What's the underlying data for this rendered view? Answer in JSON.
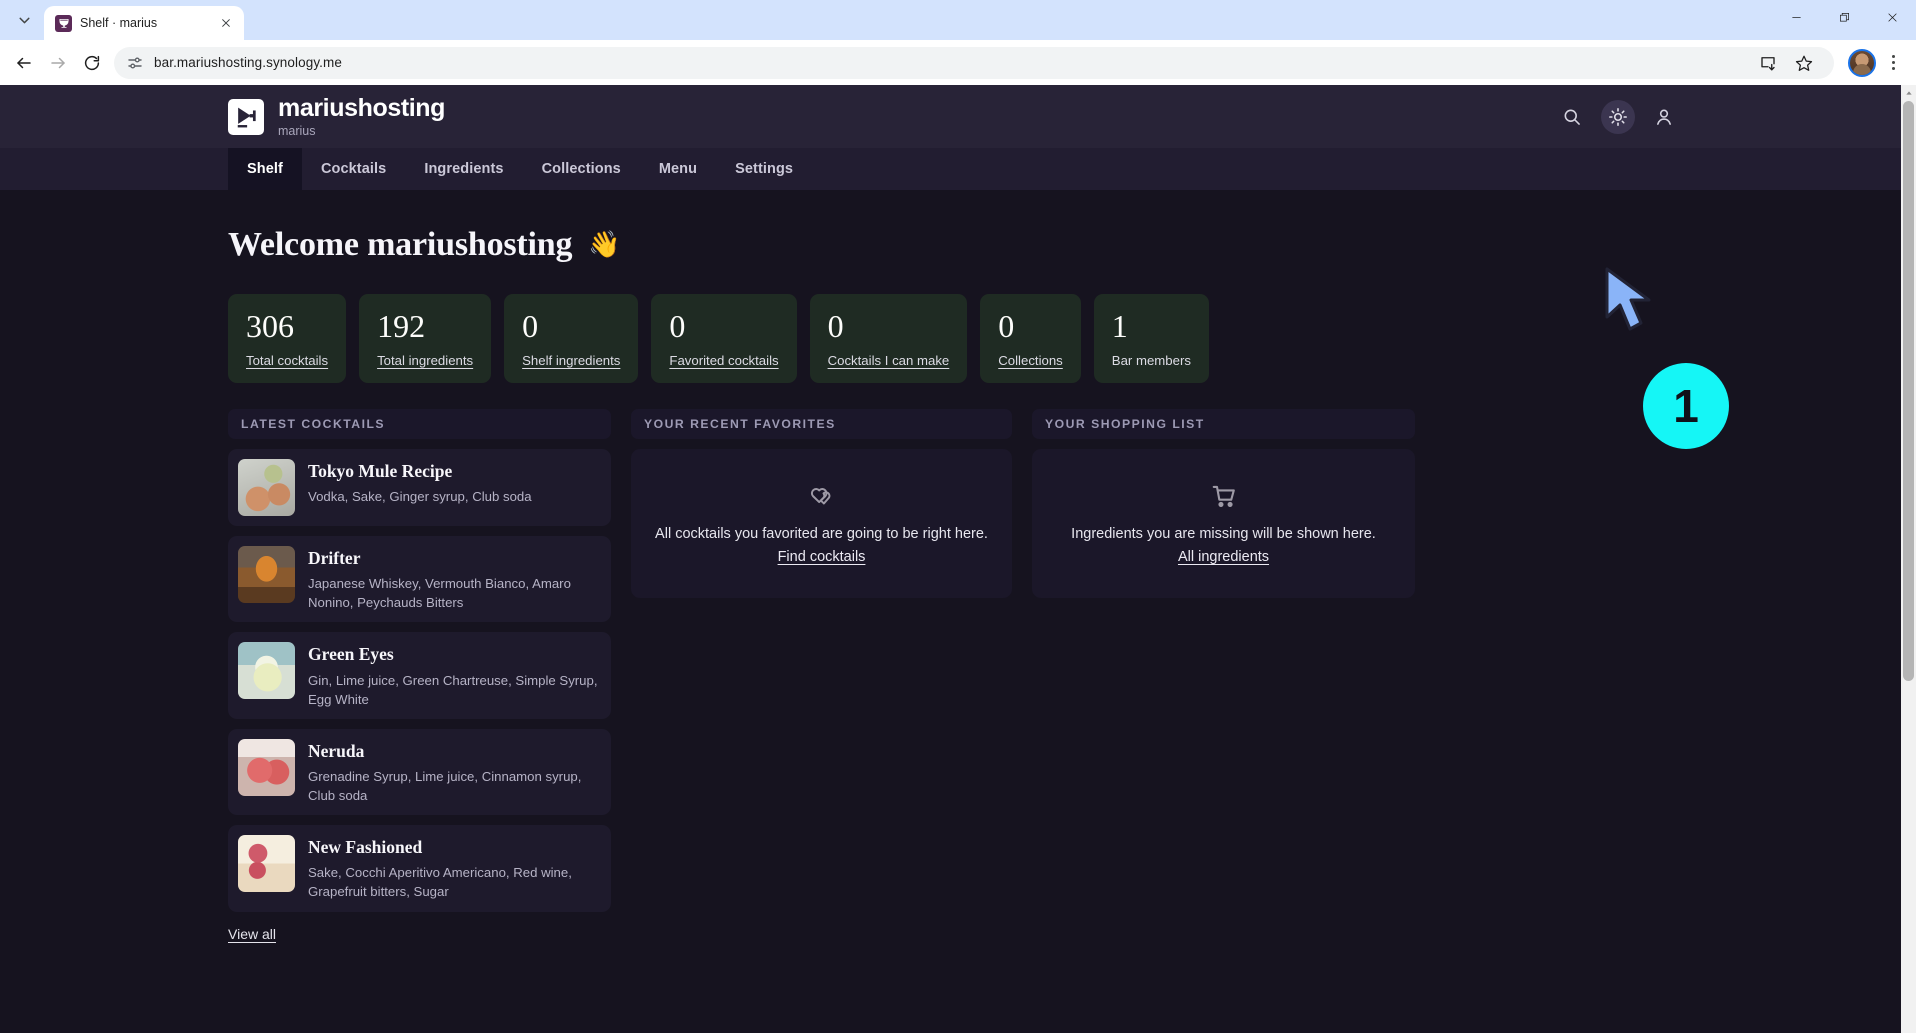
{
  "browser": {
    "tab": {
      "title": "Shelf · marius",
      "favicon_icon": "cocktail-glass-icon",
      "close_icon": "close-icon"
    },
    "tabstrip": {
      "chevron_icon": "chevron-down-icon"
    },
    "window_controls": {
      "minimize": "minimize-icon",
      "maximize": "restore-icon",
      "close": "close-icon"
    },
    "toolbar": {
      "back_icon": "arrow-back-icon",
      "forward_icon": "arrow-forward-icon",
      "reload_icon": "reload-icon",
      "site_info_icon": "tune-settings-icon",
      "url": "bar.mariushosting.synology.me",
      "url_placeholder": "Search Google or type a URL",
      "install_icon": "install-app-icon",
      "bookmark_icon": "star-outline-icon",
      "profile_icon": "account-avatar",
      "menu_icon": "three-dot-menu-icon"
    }
  },
  "site": {
    "brand": {
      "name": "mariushosting",
      "subtitle": "marius",
      "logo_icon": "cocktail-glass-icon"
    },
    "header_actions": [
      {
        "name": "search",
        "icon": "search-icon",
        "hovered": false
      },
      {
        "name": "theme-toggle",
        "icon": "sun-brightness-icon",
        "hovered": true
      },
      {
        "name": "account",
        "icon": "person-icon",
        "hovered": false
      }
    ],
    "nav": [
      {
        "label": "Shelf",
        "active": true
      },
      {
        "label": "Cocktails",
        "active": false
      },
      {
        "label": "Ingredients",
        "active": false
      },
      {
        "label": "Collections",
        "active": false
      },
      {
        "label": "Menu",
        "active": false
      },
      {
        "label": "Settings",
        "active": false
      }
    ],
    "welcome": {
      "text": "Welcome mariushosting",
      "emoji": "👋"
    },
    "stats": [
      {
        "value": "306",
        "label": "Total cocktails",
        "is_link": true
      },
      {
        "value": "192",
        "label": "Total ingredients",
        "is_link": true
      },
      {
        "value": "0",
        "label": "Shelf ingredients",
        "is_link": true
      },
      {
        "value": "0",
        "label": "Favorited cocktails",
        "is_link": true
      },
      {
        "value": "0",
        "label": "Cocktails I can make",
        "is_link": true
      },
      {
        "value": "0",
        "label": "Collections",
        "is_link": true
      },
      {
        "value": "1",
        "label": "Bar members",
        "is_link": false
      }
    ],
    "panels": {
      "latest": {
        "title": "LATEST COCKTAILS",
        "view_all": "View all",
        "items": [
          {
            "name": "Tokyo Mule Recipe",
            "ingredients": "Vodka, Sake, Ginger syrup, Club soda"
          },
          {
            "name": "Drifter",
            "ingredients": "Japanese Whiskey, Vermouth Bianco, Amaro Nonino, Peychauds Bitters"
          },
          {
            "name": "Green Eyes",
            "ingredients": "Gin, Lime juice, Green Chartreuse, Simple Syrup, Egg White"
          },
          {
            "name": "Neruda",
            "ingredients": "Grenadine Syrup, Lime juice, Cinnamon syrup, Club soda"
          },
          {
            "name": "New Fashioned",
            "ingredients": "Sake, Cocchi Aperitivo Americano, Red wine, Grapefruit bitters, Sugar"
          }
        ]
      },
      "favorites": {
        "title": "YOUR RECENT FAVORITES",
        "icon": "double-heart-icon",
        "empty_text": "All cocktails you favorited are going to be right here.",
        "link": "Find cocktails"
      },
      "shopping": {
        "title": "YOUR SHOPPING LIST",
        "icon": "shopping-cart-icon",
        "empty_text": "Ingredients you are missing will be shown here.",
        "link": "All ingredients"
      }
    }
  },
  "annotation": {
    "step_number": "1",
    "cursor_icon": "mouse-pointer-arrow",
    "badge_color": "#15f6f6"
  }
}
